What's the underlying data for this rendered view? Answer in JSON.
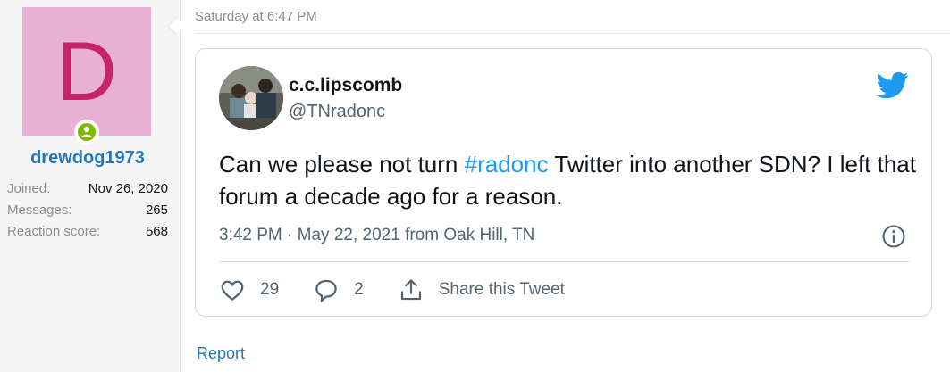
{
  "user": {
    "avatar_letter": "D",
    "avatar_bg": "#e8b0d2",
    "avatar_fg": "#c4246e",
    "online_icon": "user-online-icon",
    "username": "drewdog1973",
    "stats": [
      {
        "label": "Joined:",
        "value": "Nov 26, 2020"
      },
      {
        "label": "Messages:",
        "value": "265"
      },
      {
        "label": "Reaction score:",
        "value": "568"
      }
    ]
  },
  "post": {
    "date": "Saturday at 6:47 PM",
    "report_label": "Report"
  },
  "tweet": {
    "name": "c.c.lipscomb",
    "handle": "@TNradonc",
    "logo_icon": "twitter-bird-icon",
    "text_before": "Can we please not turn ",
    "hashtag": "#radonc",
    "text_after": " Twitter into another SDN? I left that forum a decade ago for a reason.",
    "time": "3:42 PM",
    "separator": " · ",
    "date": "May 22, 2021 from Oak Hill, TN",
    "likes": "29",
    "replies": "2",
    "share_label": "Share this Tweet",
    "accent": "#1d9bf0"
  }
}
